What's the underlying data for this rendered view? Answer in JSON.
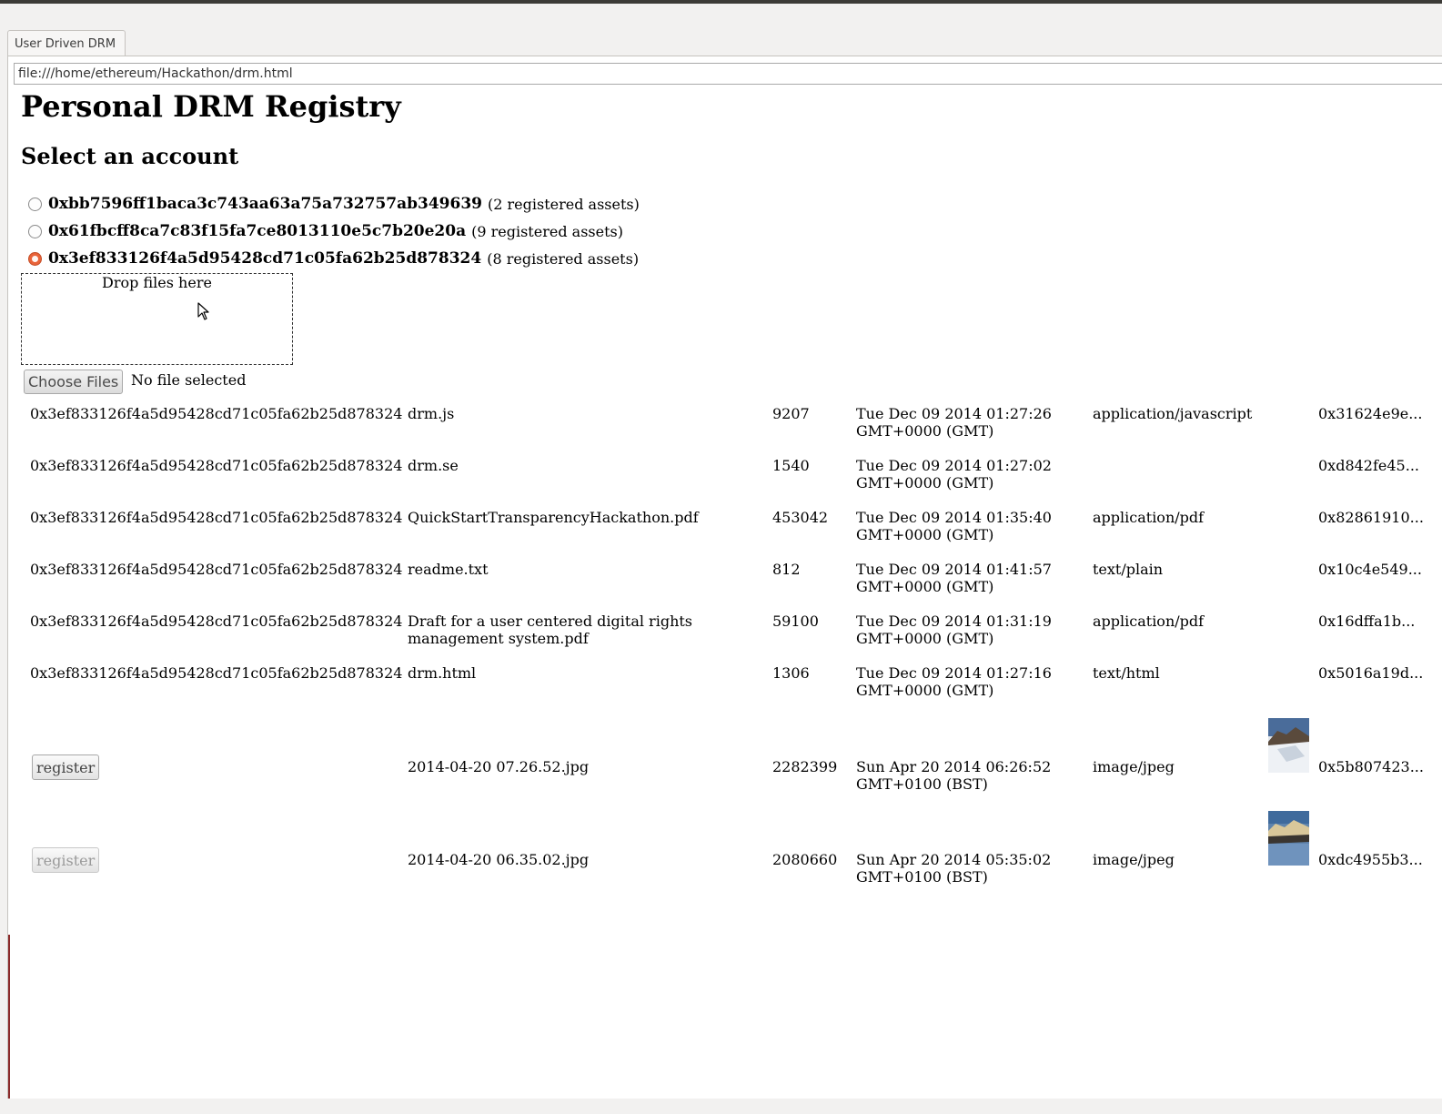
{
  "window": {
    "tab_title": "User Driven DRM",
    "url": "file:///home/ethereum/Hackathon/drm.html"
  },
  "page": {
    "title": "Personal DRM Registry",
    "subtitle": "Select an account"
  },
  "accounts": [
    {
      "address": "0xbb7596ff1baca3c743aa63a75a732757ab349639",
      "count": "(2 registered assets)",
      "selected": false
    },
    {
      "address": "0x61fbcff8ca7c83f15fa7ce8013110e5c7b20e20a",
      "count": "(9 registered assets)",
      "selected": false
    },
    {
      "address": "0x3ef833126f4a5d95428cd71c05fa62b25d878324",
      "count": "(8 registered assets)",
      "selected": true
    }
  ],
  "upload": {
    "drop_label": "Drop files here",
    "choose_label": "Choose Files",
    "no_file": "No file selected"
  },
  "assets": [
    {
      "owner": "0x3ef833126f4a5d95428cd71c05fa62b25d878324",
      "name": "drm.js",
      "size": "9207",
      "date1": "Tue Dec 09 2014 01:27:26",
      "date2": "GMT+0000 (GMT)",
      "type": "application/javascript",
      "hash": "0x31624e9e..."
    },
    {
      "owner": "0x3ef833126f4a5d95428cd71c05fa62b25d878324",
      "name": "drm.se",
      "size": "1540",
      "date1": "Tue Dec 09 2014 01:27:02",
      "date2": "GMT+0000 (GMT)",
      "type": "",
      "hash": "0xd842fe45..."
    },
    {
      "owner": "0x3ef833126f4a5d95428cd71c05fa62b25d878324",
      "name": "QuickStartTransparencyHackathon.pdf",
      "size": "453042",
      "date1": "Tue Dec 09 2014 01:35:40",
      "date2": "GMT+0000 (GMT)",
      "type": "application/pdf",
      "hash": "0x82861910..."
    },
    {
      "owner": "0x3ef833126f4a5d95428cd71c05fa62b25d878324",
      "name": "readme.txt",
      "size": "812",
      "date1": "Tue Dec 09 2014 01:41:57",
      "date2": "GMT+0000 (GMT)",
      "type": "text/plain",
      "hash": "0x10c4e549..."
    },
    {
      "owner": "0x3ef833126f4a5d95428cd71c05fa62b25d878324",
      "name": "Draft for a user centered digital rights management system.pdf",
      "size": "59100",
      "date1": "Tue Dec 09 2014 01:31:19",
      "date2": "GMT+0000 (GMT)",
      "type": "application/pdf",
      "hash": "0x16dffa1b..."
    },
    {
      "owner": "0x3ef833126f4a5d95428cd71c05fa62b25d878324",
      "name": "drm.html",
      "size": "1306",
      "date1": "Tue Dec 09 2014 01:27:16",
      "date2": "GMT+0000 (GMT)",
      "type": "text/html",
      "hash": "0x5016a19d..."
    }
  ],
  "pending": [
    {
      "button": "register",
      "enabled": true,
      "name": "2014-04-20 07.26.52.jpg",
      "size": "2282399",
      "date1": "Sun Apr 20 2014 06:26:52",
      "date2": "GMT+0100 (BST)",
      "type": "image/jpeg",
      "hash": "0x5b807423..."
    },
    {
      "button": "register",
      "enabled": false,
      "name": "2014-04-20 06.35.02.jpg",
      "size": "2080660",
      "date1": "Sun Apr 20 2014 05:35:02",
      "date2": "GMT+0100 (BST)",
      "type": "image/jpeg",
      "hash": "0xdc4955b3..."
    }
  ]
}
